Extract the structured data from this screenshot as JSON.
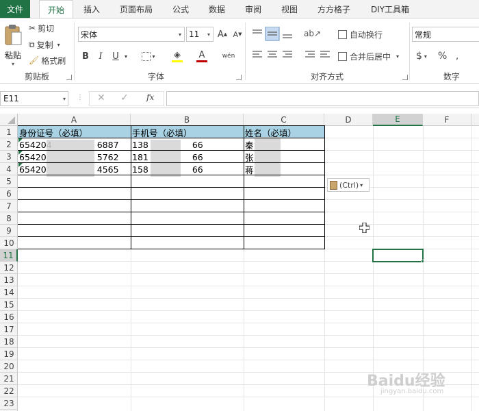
{
  "tabs": {
    "file": "文件",
    "home": "开始",
    "insert": "插入",
    "layout": "页面布局",
    "formula": "公式",
    "data": "数据",
    "review": "审阅",
    "view": "视图",
    "ffgz": "方方格子",
    "diy": "DIY工具箱"
  },
  "clipboard": {
    "paste": "粘贴",
    "cut": "剪切",
    "copy": "复制",
    "format_painter": "格式刷",
    "group": "剪贴板"
  },
  "font": {
    "name": "宋体",
    "size": "11",
    "group": "字体",
    "bold": "B",
    "italic": "I",
    "underline": "U",
    "wen": "wén"
  },
  "align": {
    "wrap": "自动换行",
    "merge": "合并后居中",
    "group": "对齐方式"
  },
  "number": {
    "format": "常规",
    "group": "数字",
    "currency": "$",
    "percent": "%"
  },
  "formula_bar": {
    "name_box": "E11",
    "fx": "fx"
  },
  "columns": [
    "A",
    "B",
    "C",
    "D",
    "E",
    "F"
  ],
  "rows": [
    "1",
    "2",
    "3",
    "4",
    "5",
    "6",
    "7",
    "8",
    "9",
    "10",
    "11",
    "12",
    "13",
    "14",
    "15",
    "16",
    "17",
    "18",
    "19",
    "20",
    "21",
    "22",
    "23"
  ],
  "table": {
    "headers": [
      "身份证号（必填）",
      "手机号（必填）",
      "姓名（必填）"
    ],
    "rows": [
      {
        "a1": "654204",
        "a2": "6887",
        "b1": "138",
        "b2": "66",
        "c": "秦"
      },
      {
        "a1": "65420",
        "a2": "5762",
        "b1": "181",
        "b2": "66",
        "c": "张"
      },
      {
        "a1": "65420",
        "a2": "4565",
        "b1": "158",
        "b2": "66",
        "c": "蒋"
      }
    ]
  },
  "paste_options": "(Ctrl)",
  "watermark": "Baidu经验",
  "watermark_sub": "jingyan.baidu.com",
  "colors": {
    "accent": "#217346",
    "header_fill": "#a9d3e4"
  }
}
